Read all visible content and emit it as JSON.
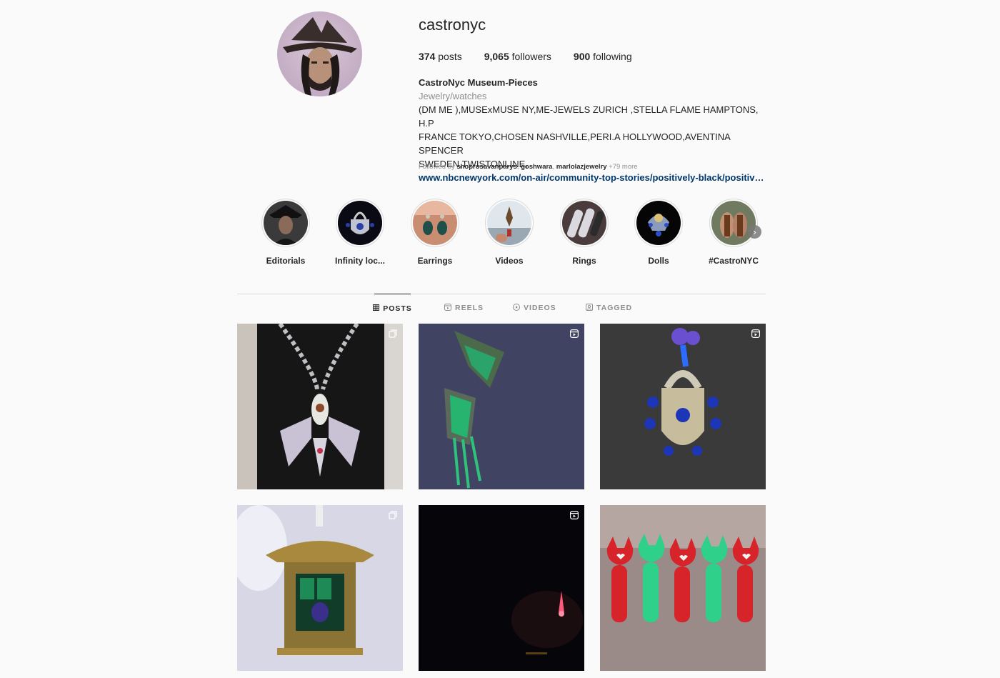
{
  "profile": {
    "username": "castronyc",
    "stats": {
      "posts_count": "374",
      "posts_label": "posts",
      "followers_count": "9,065",
      "followers_label": "followers",
      "following_count": "900",
      "following_label": "following"
    },
    "bio": {
      "name": "CastroNyc Museum-Pieces",
      "category": "Jewelry/watches",
      "line1": "(DM ME ),MUSExMUSE NY,ME-JEWELS ZURICH ,STELLA FLAME HAMPTONS, H.P",
      "line2": "FRANCE TOKYO,CHOSEN NASHVILLE,PERI.A HOLLYWOOD,AVENTINA SPENCER",
      "line3": "SWEDEN,TWISTONLINE,",
      "link": "www.nbcnewyork.com/on-air/community-top-stories/positively-black/positivel..."
    },
    "followed_by": {
      "prefix": "Followed by",
      "user1": "shoprosavanparys",
      "user2": "goshwara",
      "user3": "marlolazjewelry",
      "more": "+79 more"
    }
  },
  "highlights": [
    {
      "label": "Editorials"
    },
    {
      "label": "Infinity loc..."
    },
    {
      "label": "Earrings"
    },
    {
      "label": "Videos"
    },
    {
      "label": "Rings"
    },
    {
      "label": "Dolls"
    },
    {
      "label": "#CastroNYC"
    }
  ],
  "tabs": [
    {
      "label": "POSTS",
      "icon": "grid-icon",
      "active": true
    },
    {
      "label": "REELS",
      "icon": "reels-icon",
      "active": false
    },
    {
      "label": "VIDEOS",
      "icon": "play-icon",
      "active": false
    },
    {
      "label": "TAGGED",
      "icon": "tag-icon",
      "active": false
    }
  ],
  "posts": [
    {
      "subject": "bird-necklace",
      "type": "carousel"
    },
    {
      "subject": "emerald-earring",
      "type": "reel"
    },
    {
      "subject": "sapphire-padlock",
      "type": "reel"
    },
    {
      "subject": "pagoda-pendant",
      "type": "carousel"
    },
    {
      "subject": "dark-video",
      "type": "reel"
    },
    {
      "subject": "enamel-cats",
      "type": "none"
    }
  ],
  "colors": {
    "background": "#fafafa",
    "text": "#262626",
    "muted": "#8e8e8e",
    "link": "#00376b",
    "border": "#dbdbdb"
  }
}
